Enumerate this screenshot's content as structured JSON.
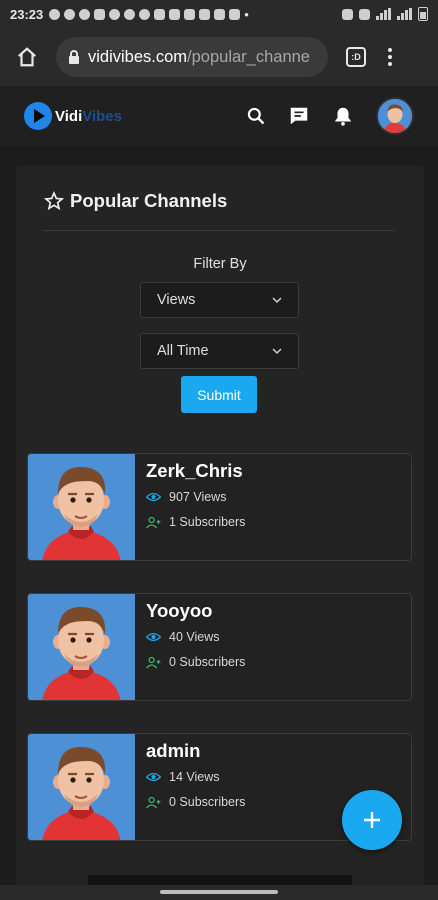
{
  "status_bar": {
    "time": "23:23",
    "notification_icons": [
      "whatsapp-icon",
      "whatsapp-icon",
      "facebook-messenger-icon",
      "chat-icon",
      "facebook-icon",
      "facebook-icon",
      "facebook-icon",
      "snapchat-icon",
      "snapchat-icon",
      "snapchat-icon",
      "youtube-icon",
      "youtube-icon",
      "youtube-icon"
    ],
    "dot": "•"
  },
  "browser": {
    "url_domain": "vidivibes.com",
    "url_path": "/popular_channe",
    "tab_count": ":D"
  },
  "site": {
    "logo_part1": "Vidi",
    "logo_part2": "Vibes"
  },
  "page": {
    "title": "Popular Channels",
    "filter_label": "Filter By",
    "filter_sort_value": "Views",
    "filter_time_value": "All Time",
    "submit_label": "Submit"
  },
  "channels": [
    {
      "name": "Zerk_Chris",
      "views": "907 Views",
      "subscribers": "1 Subscribers"
    },
    {
      "name": "Yooyoo",
      "views": "40 Views",
      "subscribers": "0 Subscribers"
    },
    {
      "name": "admin",
      "views": "14 Views",
      "subscribers": "0 Subscribers"
    }
  ],
  "fab": {
    "label": "+"
  },
  "colors": {
    "accent": "#1aa9f0",
    "background": "#1c1c1c",
    "card": "#242424",
    "avatar_bg": "#4d90d6",
    "stat_icon_blue": "#1aa9f0",
    "stat_icon_green": "#3fb56b"
  }
}
